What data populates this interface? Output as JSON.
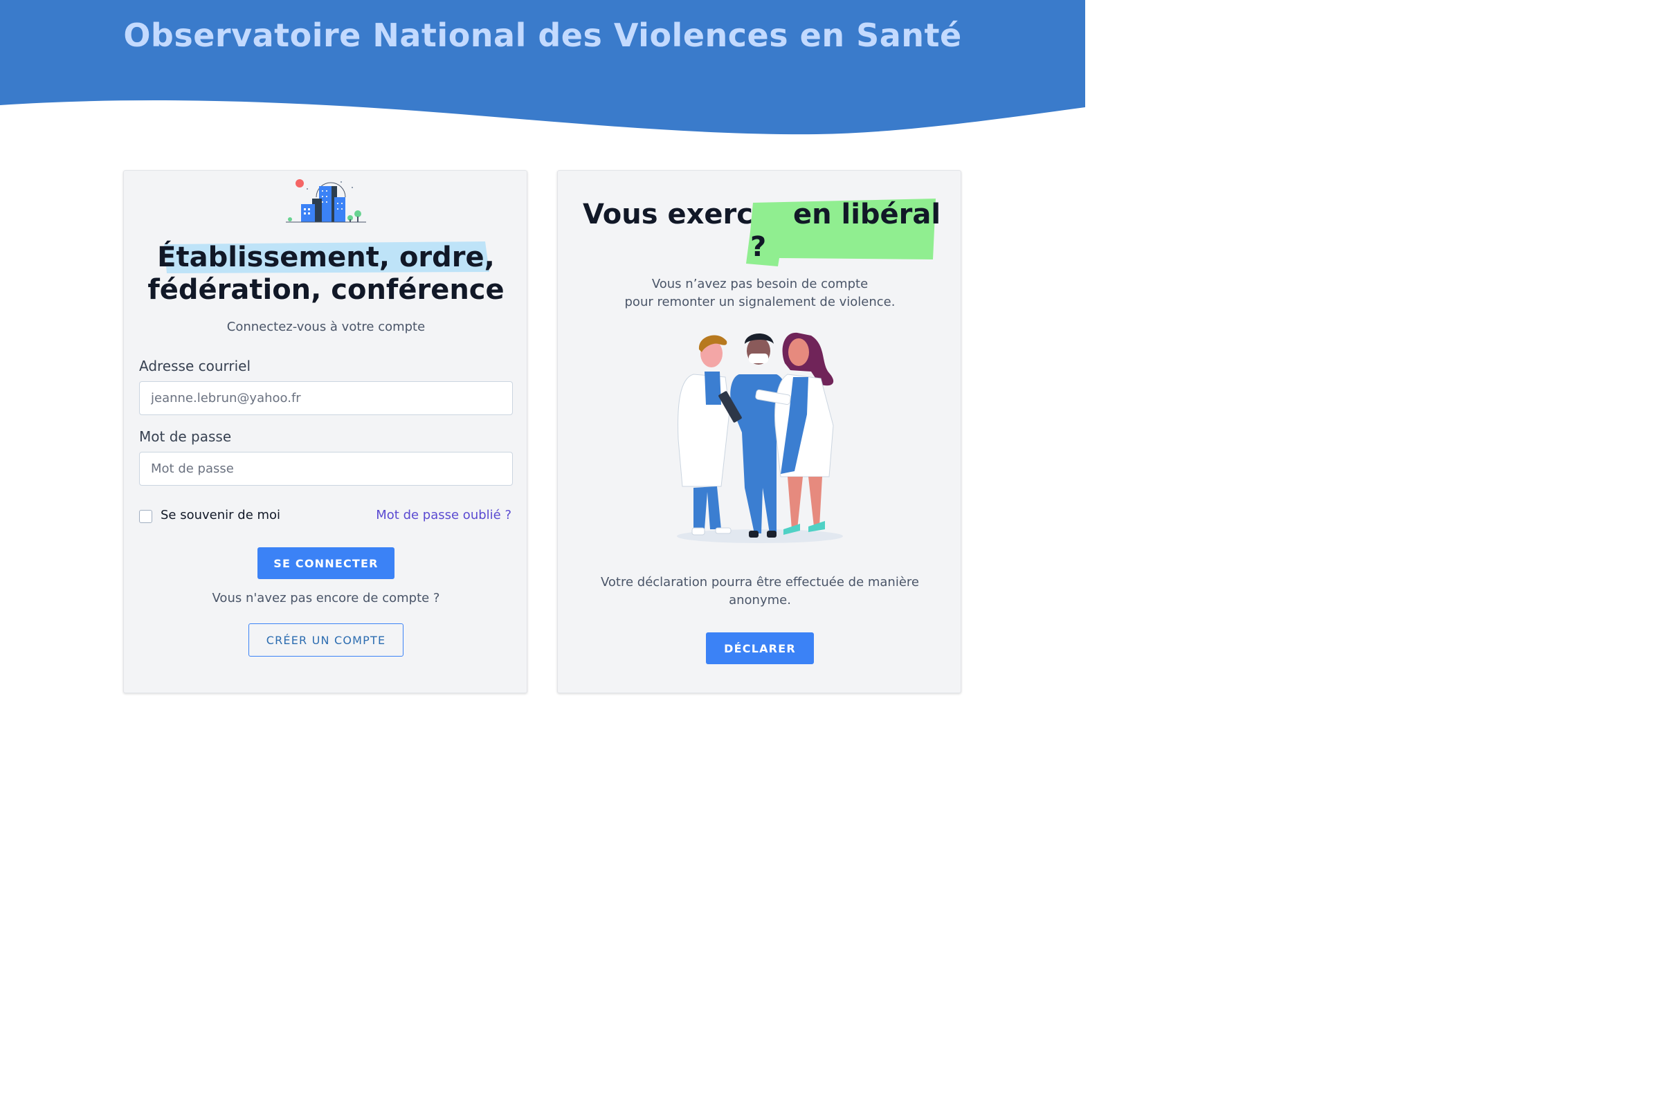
{
  "header": {
    "title": "Observatoire National des Violences en Santé",
    "bg_color": "#3a7bcb",
    "title_color": "#c3dafe"
  },
  "login_card": {
    "illustration": "city-buildings-illustration",
    "title_line1": "Établissement, ordre,",
    "title_line2": "fédération, conférence",
    "subtitle": "Connectez-vous à votre compte",
    "email_label": "Adresse courriel",
    "email_placeholder": "jeanne.lebrun@yahoo.fr",
    "password_label": "Mot de passe",
    "password_placeholder": "Mot de passe",
    "remember_label": "Se souvenir de moi",
    "forgot_link": "Mot de passe oublié ?",
    "login_button": "SE CONNECTER",
    "no_account_text": "Vous n'avez pas encore de compte ?",
    "create_account_button": "CRÉER UN COMPTE"
  },
  "liberal_card": {
    "title_part1": "Vous exerc",
    "title_part2": "en libéral",
    "title_part3": "?",
    "intro_line1": "Vous n’avez pas besoin de compte",
    "intro_line2": "pour remonter un signalement de violence.",
    "illustration": "medical-staff-illustration",
    "anonymous_text": "Votre déclaration pourra être effectuée de manière anonyme.",
    "declare_button": "DÉCLARER"
  },
  "colors": {
    "accent": "#3b82f6",
    "highlight_blue": "#bee3f8",
    "highlight_green": "#90ee90",
    "link": "#5a4ad1"
  }
}
